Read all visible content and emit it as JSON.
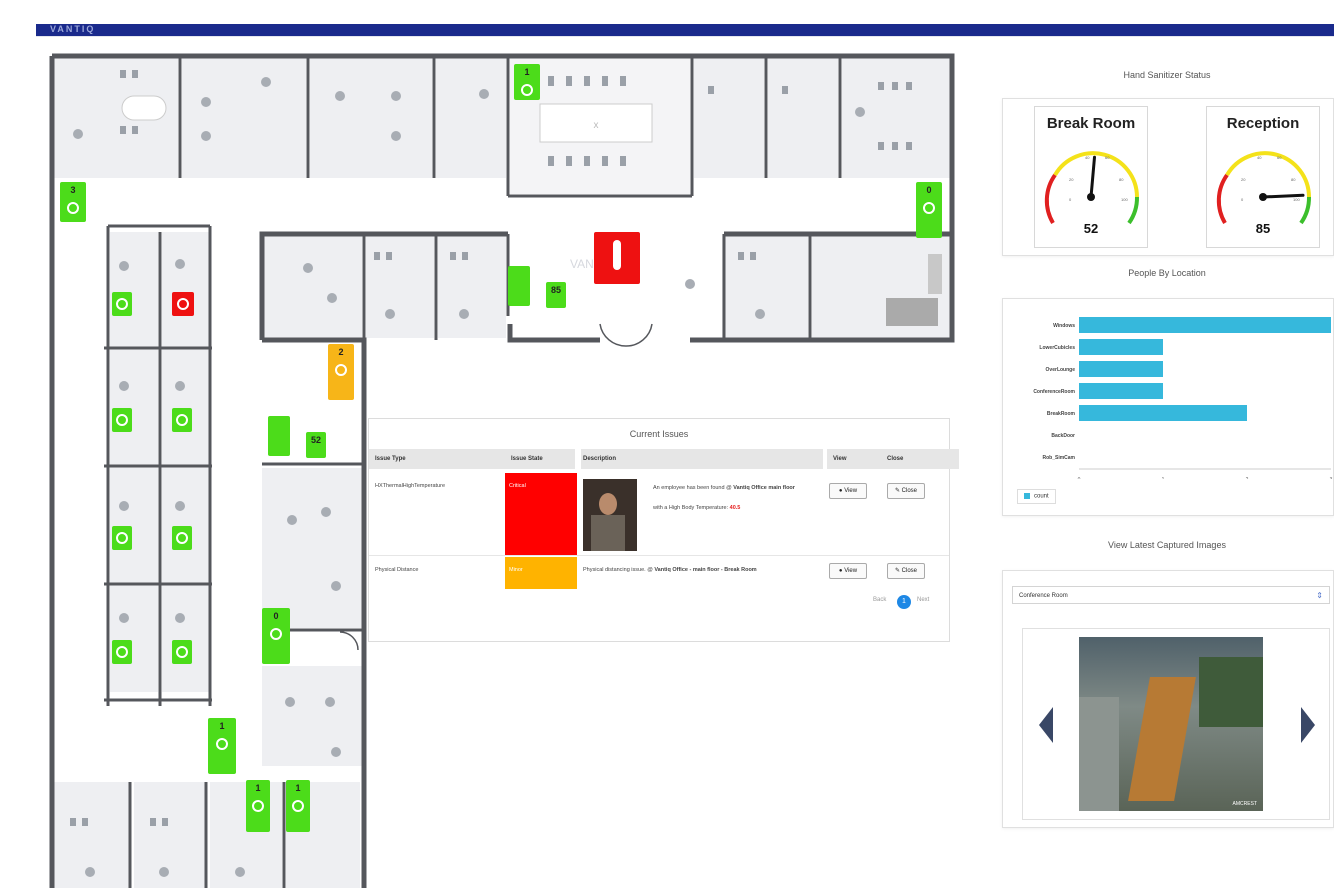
{
  "header": {
    "logo_text": "VANTIQ"
  },
  "floor_plan": {
    "watermark": "VANTI",
    "sensors": [
      {
        "id": "s1",
        "count": "1",
        "status": "green"
      },
      {
        "id": "s2",
        "count": "3",
        "status": "green"
      },
      {
        "id": "s3",
        "count": "0",
        "status": "green"
      },
      {
        "id": "s4",
        "count": "2",
        "status": "orange"
      },
      {
        "id": "s5",
        "count": "0",
        "status": "green"
      },
      {
        "id": "s6",
        "count": "1",
        "status": "green"
      },
      {
        "id": "s7",
        "count": "1",
        "status": "green"
      },
      {
        "id": "s8",
        "count": "1",
        "status": "green"
      }
    ],
    "dispensers": [
      {
        "id": "d1",
        "value": "85"
      },
      {
        "id": "d2",
        "value": "52"
      }
    ]
  },
  "current_issues": {
    "title": "Current Issues",
    "columns": [
      "Issue Type",
      "Issue State",
      "Description",
      "View",
      "Close"
    ],
    "rows": [
      {
        "type": "HXThermalHighTemperature",
        "state": "Critical",
        "state_color": "#ff0000",
        "desc_line1": "An employee has been found @",
        "desc_bold1": "Vantiq Office main floor",
        "desc_line2": "with a High Body Temperature:",
        "desc_temp": "40.5"
      },
      {
        "type": "Physical Distance",
        "state": "Minor",
        "state_color": "#ffb300",
        "desc_line1": "Physical distancing issue. @",
        "desc_bold1": "Vantiq Office - main floor - Break Room"
      }
    ],
    "view_label": "View",
    "close_label": "Close",
    "pager": {
      "back": "Back",
      "page": "1",
      "next": "Next"
    }
  },
  "hand_sanitizer": {
    "title": "Hand Sanitizer Status",
    "gauges": [
      {
        "name": "Break Room",
        "value": 52
      },
      {
        "name": "Reception",
        "value": 85
      }
    ]
  },
  "people_by_location": {
    "title": "People By Location",
    "legend": "count"
  },
  "chart_data": {
    "type": "bar",
    "orientation": "horizontal",
    "categories": [
      "Windows",
      "LowerCubicles",
      "OverLounge",
      "ConferenceRoom",
      "BreakRoom",
      "BackDoor",
      "Rob_SimCam"
    ],
    "series": [
      {
        "name": "count",
        "values": [
          3,
          1,
          1,
          1,
          2,
          0,
          0
        ]
      }
    ],
    "xlim": [
      0,
      3
    ],
    "xticks": [
      "0",
      "1",
      "2",
      "3"
    ]
  },
  "captured_images": {
    "title": "View Latest Captured Images",
    "selected": "Conference Room",
    "cam_brand": "AMCREST"
  }
}
